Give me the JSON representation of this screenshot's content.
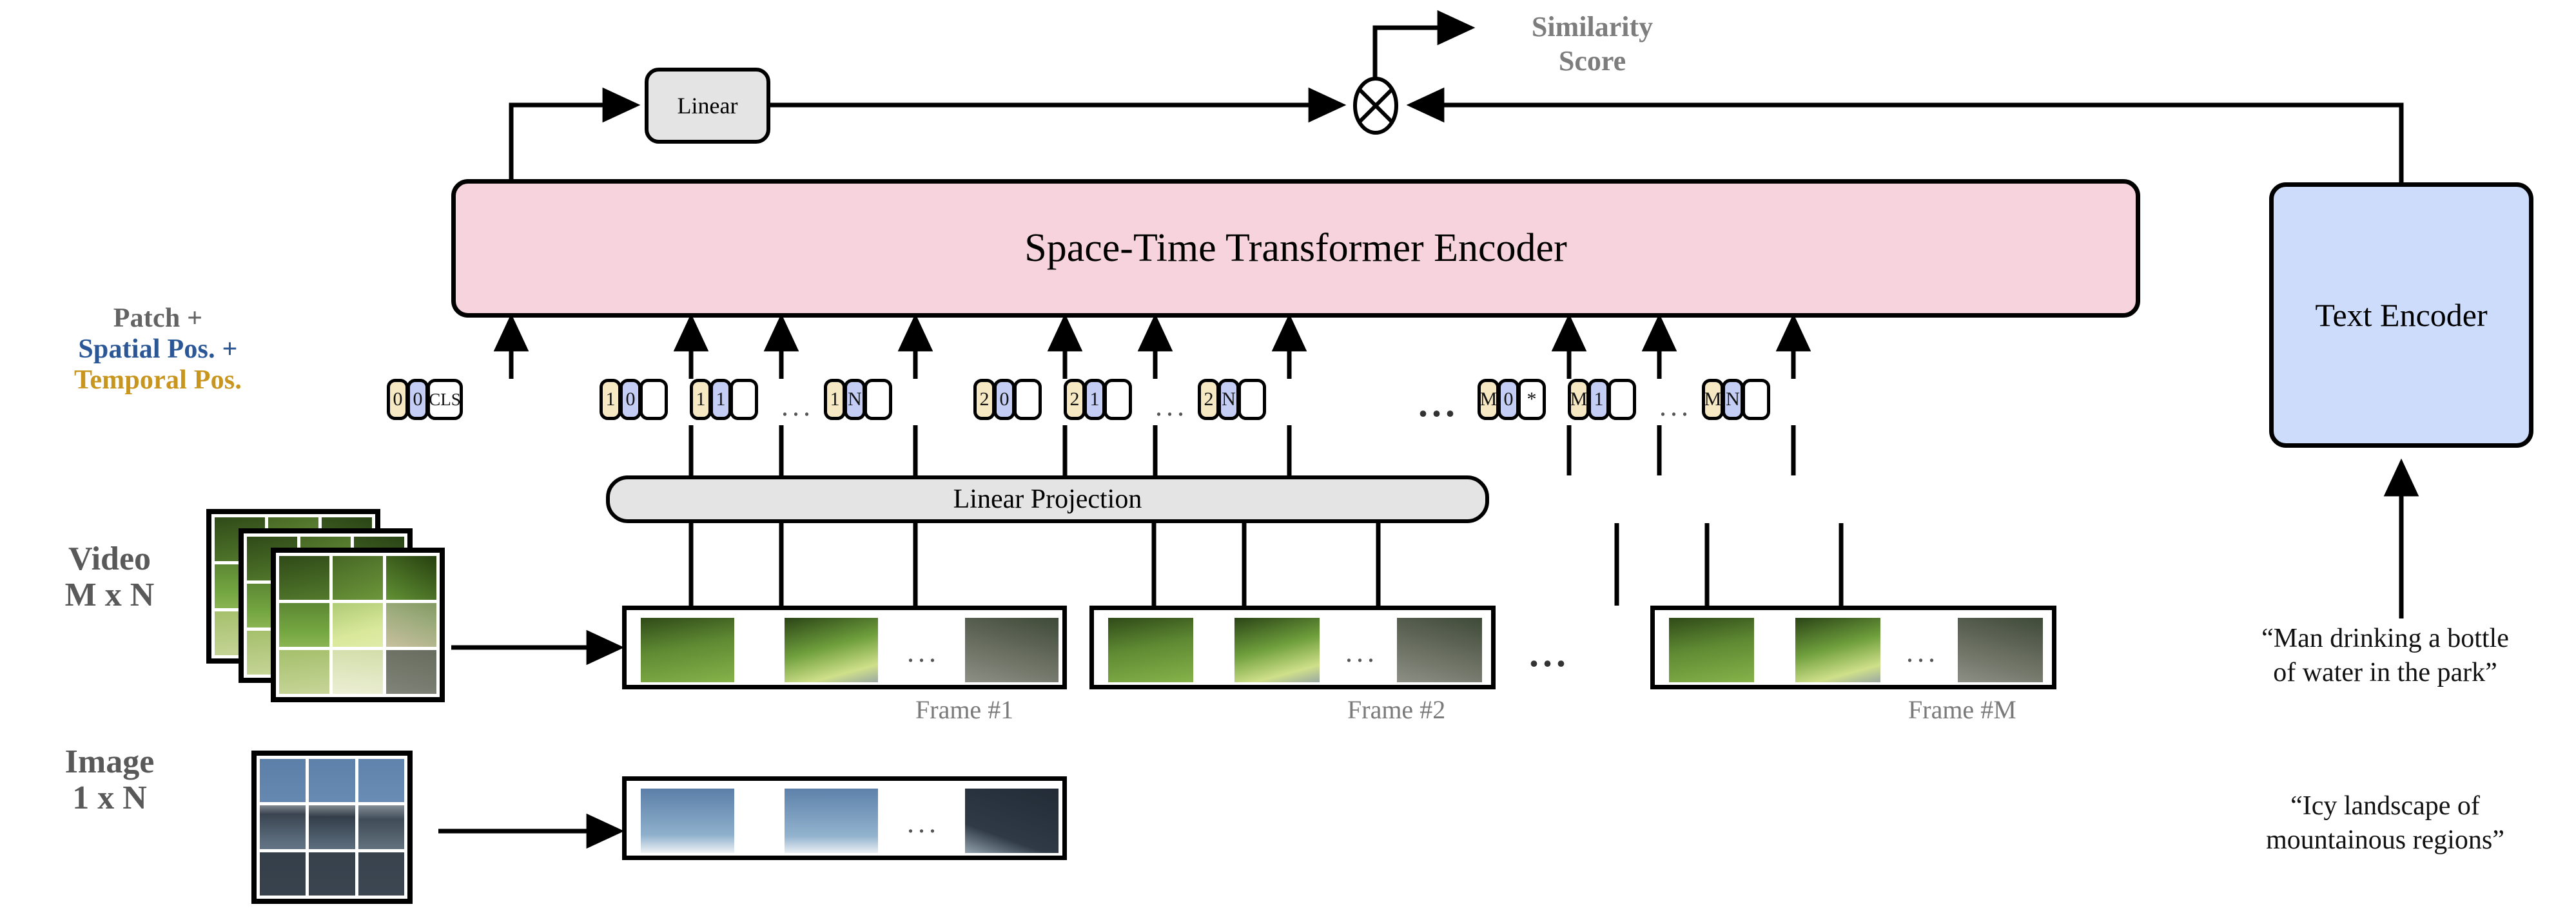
{
  "diagram": {
    "title": "Space-Time Transformer Encoder video-text retrieval architecture"
  },
  "legend": {
    "line1": "Patch +",
    "line2": "Spatial Pos. +",
    "line3": "Temporal Pos.",
    "color_patch": "#636363",
    "color_spatial": "#2b5797",
    "color_temporal": "#c8951f"
  },
  "modality_labels": {
    "video_line1": "Video",
    "video_line2": "M x N",
    "image_line1": "Image",
    "image_line2": "1 x N"
  },
  "blocks": {
    "encoder": "Space-Time Transformer Encoder",
    "encoder_color": "#f7d4dd",
    "text_encoder": "Text Encoder",
    "text_encoder_color": "#ccdcfa",
    "linear": "Linear",
    "linear_color": "#e4e4e4",
    "linear_projection": "Linear Projection",
    "linear_projection_color": "#e4e4e4"
  },
  "output": {
    "similarity_line1": "Similarity",
    "similarity_line2": "Score",
    "operator": "multiply-circle-icon"
  },
  "tokens": [
    {
      "temporal": "0",
      "spatial": "0",
      "patch": "CLS"
    },
    {
      "temporal": "1",
      "spatial": "0",
      "patch": ""
    },
    {
      "temporal": "1",
      "spatial": "1",
      "patch": ""
    },
    {
      "temporal": "1",
      "spatial": "N",
      "patch": ""
    },
    {
      "temporal": "2",
      "spatial": "0",
      "patch": ""
    },
    {
      "temporal": "2",
      "spatial": "1",
      "patch": ""
    },
    {
      "temporal": "2",
      "spatial": "N",
      "patch": ""
    },
    {
      "temporal": "M",
      "spatial": "0",
      "patch": "*"
    },
    {
      "temporal": "M",
      "spatial": "1",
      "patch": ""
    },
    {
      "temporal": "M",
      "spatial": "N",
      "patch": ""
    }
  ],
  "token_ellipses": [
    "...",
    "...",
    "...",
    "..."
  ],
  "frames": [
    {
      "label": "Frame #1"
    },
    {
      "label": "Frame #2"
    },
    {
      "label": "Frame #M"
    }
  ],
  "frame_ellipsis": "...",
  "strip_ellipsis": "...",
  "captions": {
    "video_text": "“Man drinking a bottle\nof water in the park”",
    "image_text": "“Icy landscape of\nmountainous regions”"
  },
  "thumbnails": {
    "video_alt": "video-frames-man-drinking-water-park",
    "image_alt": "icy-landscape-mountains"
  }
}
